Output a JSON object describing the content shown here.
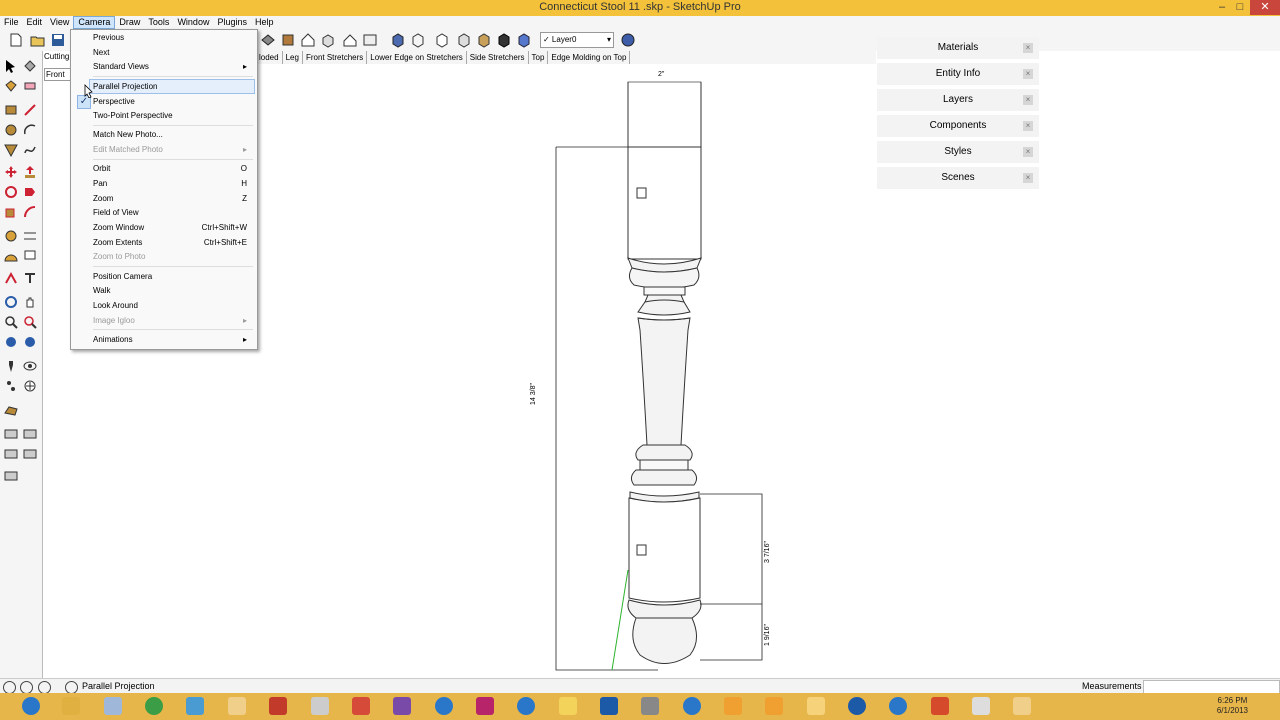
{
  "window": {
    "title": "Connecticut Stool 11 .skp - SketchUp Pro",
    "min": "–",
    "max": "□",
    "close": "✕"
  },
  "menubar": [
    "File",
    "Edit",
    "View",
    "Camera",
    "Draw",
    "Tools",
    "Window",
    "Plugins",
    "Help"
  ],
  "toolbar": {
    "layer_value": "✓ Layer0",
    "layer_arrow": "▾"
  },
  "scenes": [
    "loded",
    "Leg",
    "Front Stretchers",
    "Lower Edge on Stretchers",
    "Side Stretchers",
    "Top",
    "Edge Molding on Top"
  ],
  "left_tabs": {
    "cutting": "Cutting",
    "front": "Front"
  },
  "camera_menu": {
    "items": [
      {
        "label": "Previous",
        "shortcut": ""
      },
      {
        "label": "Next",
        "shortcut": ""
      },
      {
        "label": "Standard Views",
        "shortcut": "▸"
      },
      {
        "label": "Parallel Projection",
        "shortcut": ""
      },
      {
        "label": "Perspective",
        "shortcut": ""
      },
      {
        "label": "Two-Point Perspective",
        "shortcut": ""
      },
      {
        "label": "Match New Photo...",
        "shortcut": ""
      },
      {
        "label": "Edit Matched Photo",
        "shortcut": "▸"
      },
      {
        "label": "Orbit",
        "shortcut": "O"
      },
      {
        "label": "Pan",
        "shortcut": "H"
      },
      {
        "label": "Zoom",
        "shortcut": "Z"
      },
      {
        "label": "Field of View",
        "shortcut": ""
      },
      {
        "label": "Zoom Window",
        "shortcut": "Ctrl+Shift+W"
      },
      {
        "label": "Zoom Extents",
        "shortcut": "Ctrl+Shift+E"
      },
      {
        "label": "Zoom to Photo",
        "shortcut": ""
      },
      {
        "label": "Position Camera",
        "shortcut": ""
      },
      {
        "label": "Walk",
        "shortcut": ""
      },
      {
        "label": "Look Around",
        "shortcut": ""
      },
      {
        "label": "Image Igloo",
        "shortcut": "▸"
      },
      {
        "label": "Animations",
        "shortcut": "▸"
      }
    ],
    "check_mark": "✓"
  },
  "tray": {
    "items": [
      "Materials",
      "Entity Info",
      "Layers",
      "Components",
      "Styles",
      "Scenes"
    ],
    "close_glyph": "×"
  },
  "dimensions": {
    "top_width": "2\"",
    "height": "14 3/8\"",
    "lower_a": "3 7/16\"",
    "lower_b": "1 9/16\""
  },
  "status": {
    "text": "Parallel Projection",
    "measurements_label": "Measurements"
  },
  "clock": {
    "time": "6:26 PM",
    "date": "6/1/2013"
  },
  "colors": {
    "titlebar": "#f3c23a",
    "taskbar": "#e7b64a",
    "menu_highlight": "#e4effb",
    "close": "#c9463d"
  }
}
